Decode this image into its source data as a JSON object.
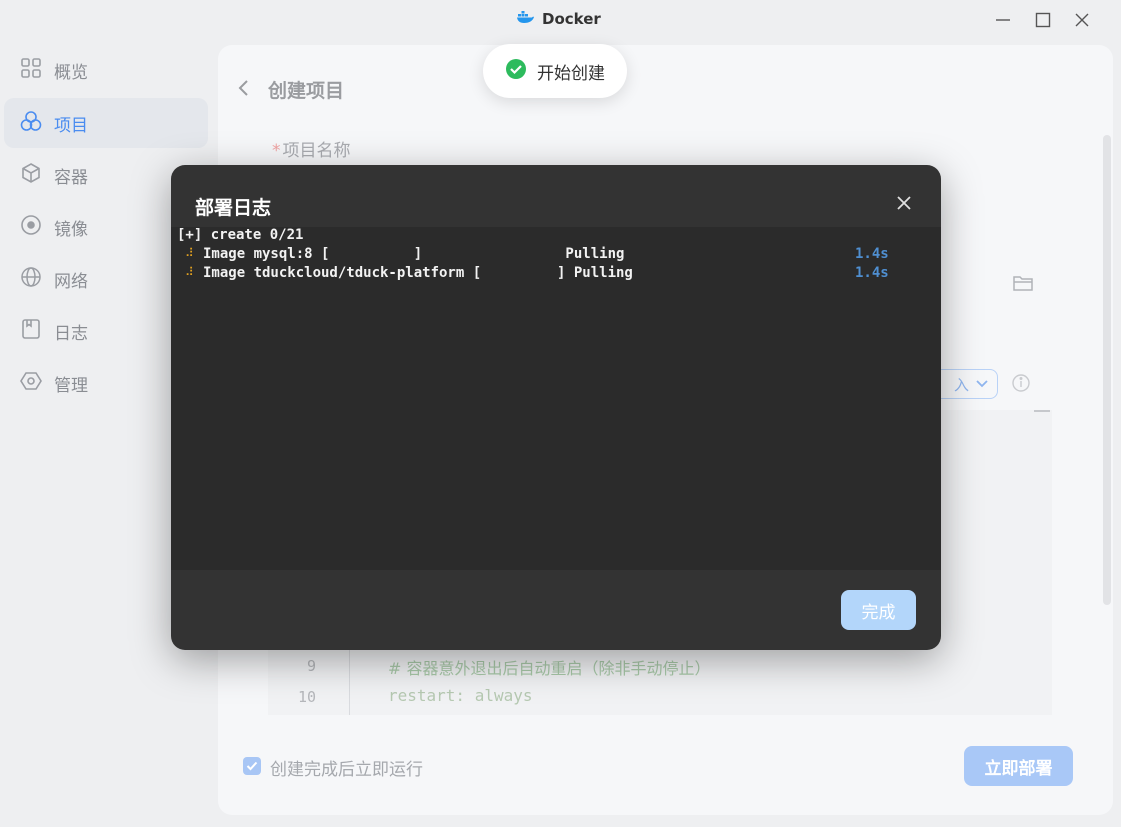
{
  "app": {
    "title": "Docker"
  },
  "sidebar": {
    "items": [
      {
        "label": "概览",
        "icon": "grid-icon"
      },
      {
        "label": "项目",
        "icon": "circles-icon",
        "active": true
      },
      {
        "label": "容器",
        "icon": "cube-icon"
      },
      {
        "label": "镜像",
        "icon": "disc-icon"
      },
      {
        "label": "网络",
        "icon": "globe-icon"
      },
      {
        "label": "日志",
        "icon": "log-icon"
      },
      {
        "label": "管理",
        "icon": "settings-icon"
      }
    ]
  },
  "page": {
    "title": "创建项目",
    "name_field": {
      "required_mark": "*",
      "label": "项目名称"
    },
    "select_partial": "入",
    "code_lines": [
      {
        "num": "9",
        "text": "# 容器意外退出后自动重启（除非手动停止）"
      },
      {
        "num": "10",
        "text": "restart: always"
      }
    ],
    "run_after_create": {
      "label": "创建完成后立即运行",
      "checked": true
    },
    "deploy_button": "立即部署"
  },
  "toast": {
    "text": "开始创建",
    "status": "success",
    "color": "#2dbb5d"
  },
  "modal": {
    "title": "部署日志",
    "log": [
      {
        "text": "[+] create 0/21"
      },
      {
        "spinner": "⠼",
        "text": "Image mysql:8 [          ]                 Pulling",
        "time": "1.4s"
      },
      {
        "spinner": "⠼",
        "text": "Image tduckcloud/tduck-platform [         ] Pulling",
        "time": "1.4s"
      }
    ],
    "done_button": "完成"
  },
  "colors": {
    "accent": "#4a8cf0",
    "modal_bg": "#333333",
    "log_time": "#4f8fd1"
  }
}
